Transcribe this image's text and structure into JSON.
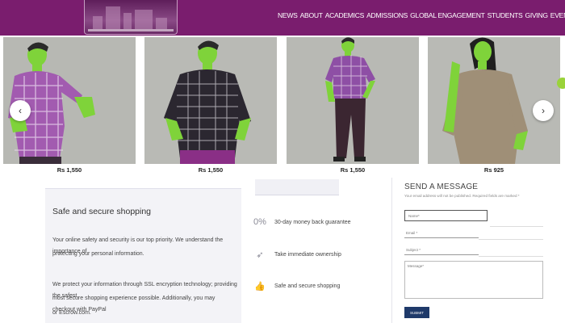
{
  "header": {
    "nav": [
      "NEWS",
      "ABOUT",
      "ACADEMICS",
      "ADMISSIONS",
      "GLOBAL ENGAGEMENT",
      "STUDENTS",
      "GIVING",
      "EVENTS"
    ]
  },
  "colors": {
    "header_bg": "#7a1d6e",
    "submit_bg": "#1f3a6a",
    "highlight_skin": "#8ad83a"
  },
  "products": [
    {
      "price": "Rs 1,550",
      "shirt": "purple-check"
    },
    {
      "price": "Rs 1,550",
      "shirt": "black-check"
    },
    {
      "price": "Rs 1,550",
      "shirt": "purple-check"
    },
    {
      "price": "Rs 925",
      "shirt": "khaki"
    }
  ],
  "carousel": {
    "prev_icon": "chevron-left-icon",
    "next_icon": "chevron-right-icon",
    "prev_glyph": "‹",
    "next_glyph": "›"
  },
  "safe": {
    "title": "Safe and secure shopping",
    "p1a": "Your online safety and security is our top priority. We understand the importance of",
    "p1b": "protecting your personal information.",
    "p2a": "We protect your information through SSL encryption technology; providing the safest,",
    "p2b": "most secure shopping experience possible. Additionally, you may checkout with PayPal",
    "p2c": "or Escrow.com."
  },
  "features": [
    {
      "icon": "percent-icon",
      "glyph": "0%",
      "label": "30-day money back guarantee"
    },
    {
      "icon": "rocket-icon",
      "glyph": "➶",
      "label": "Take immediate ownership"
    },
    {
      "icon": "thumbs-up-icon",
      "glyph": "👍",
      "label": "Safe and secure shopping"
    }
  ],
  "form": {
    "title": "SEND A MESSAGE",
    "note": "Your email address will not be published. Required fields are marked *",
    "name_placeholder": "Name*",
    "email_placeholder": "Email *",
    "subject_placeholder": "Subject *",
    "message_placeholder": "Message*",
    "submit_label": "SUBMIT"
  }
}
